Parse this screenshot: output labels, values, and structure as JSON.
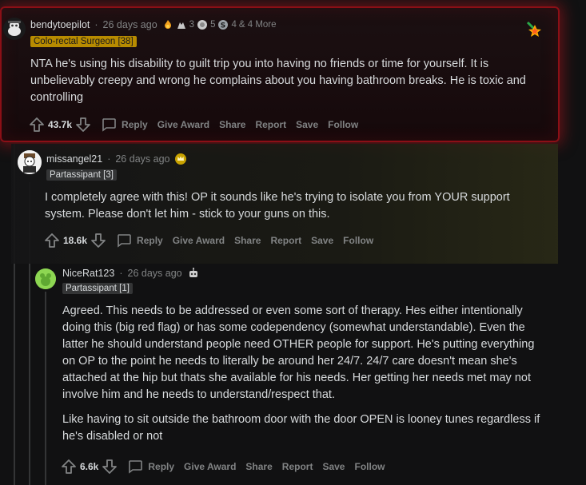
{
  "comments": [
    {
      "username": "bendytoepilot",
      "timestamp": "26 days ago",
      "awards": {
        "a1_count": "3",
        "a2_count": "5",
        "a3_count": "4",
        "more": "& 4 More"
      },
      "flair": "Colo-rectal Surgeon [38]",
      "body": [
        "NTA he's using his disability to guilt trip you into having no friends or time for yourself. It is unbelievably creepy and wrong he complains about you having bathroom breaks. He is toxic and controlling"
      ],
      "votes": "43.7k",
      "icons": [
        "upvote-icon",
        "downvote-icon",
        "reply-icon",
        "star-award-icon"
      ]
    },
    {
      "username": "missangel21",
      "timestamp": "26 days ago",
      "flair": "Partassipant [3]",
      "body": [
        "I completely agree with this! OP it sounds like he's trying to isolate you from YOUR support system. Please don't let him - stick to your guns on this."
      ],
      "votes": "18.6k"
    },
    {
      "username": "NiceRat123",
      "timestamp": "26 days ago",
      "flair": "Partassipant [1]",
      "body": [
        "Agreed. This needs to be addressed or even some sort of therapy. Hes either intentionally doing this (big red flag) or has some codependency (somewhat understandable). Even the latter he should understand people need OTHER people for support. He's putting everything on OP to the point he needs to literally be around her 24/7. 24/7 care doesn't mean she's attached at the hip but thats she available for his needs. Her getting her needs met may not involve him and he needs to understand/respect that.",
        "Like having to sit outside the bathroom door with the door OPEN is looney tunes regardless if he's disabled or not"
      ],
      "votes": "6.6k"
    }
  ],
  "actions": {
    "reply": "Reply",
    "give_award": "Give Award",
    "share": "Share",
    "report": "Report",
    "save": "Save",
    "follow": "Follow"
  },
  "colors": {
    "highlight_border": "#8b0f16",
    "gold_flair": "#b88b00",
    "text": "#d7dadc",
    "muted": "#818384"
  }
}
